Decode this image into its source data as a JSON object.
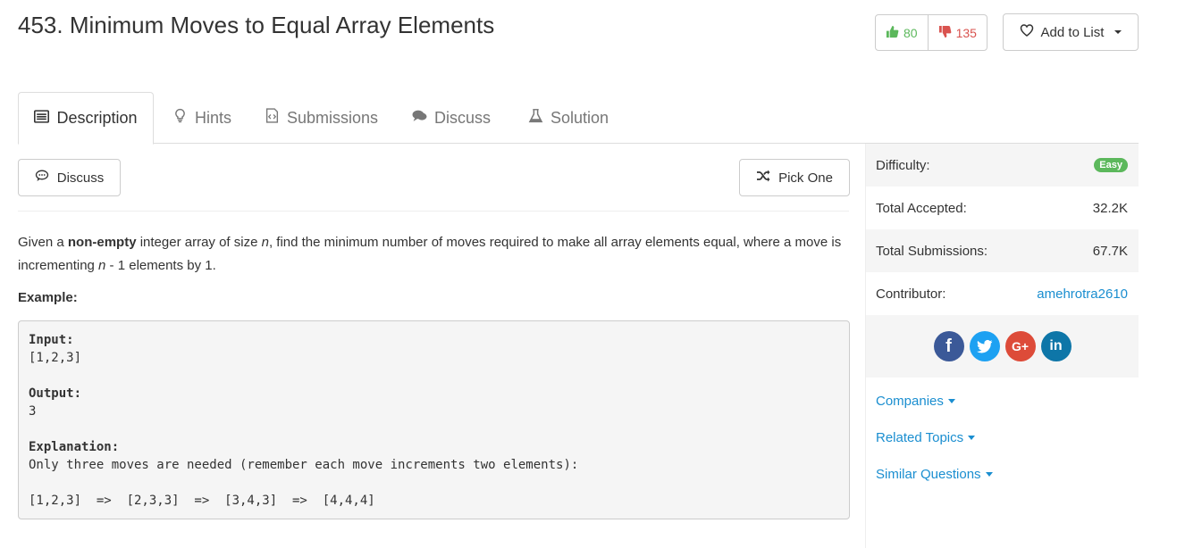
{
  "header": {
    "title": "453. Minimum Moves to Equal Array Elements",
    "upvotes": "80",
    "downvotes": "135",
    "add_to_list": "Add to List"
  },
  "tabs": [
    {
      "label": "Description",
      "icon": "list-icon"
    },
    {
      "label": "Hints",
      "icon": "lightbulb-icon"
    },
    {
      "label": "Submissions",
      "icon": "file-code-icon"
    },
    {
      "label": "Discuss",
      "icon": "comments-icon"
    },
    {
      "label": "Solution",
      "icon": "flask-icon"
    }
  ],
  "toolbar": {
    "discuss_label": "Discuss",
    "pick_one_label": "Pick One"
  },
  "problem": {
    "text_1": "Given a ",
    "bold_1": "non-empty",
    "text_2": " integer array of size ",
    "var_n": "n",
    "text_3": ", find the minimum number of moves required to make all array elements equal, where a move is incrementing ",
    "var_n2": "n",
    "text_4": " - 1 elements by 1.",
    "example_label": "Example:",
    "example": {
      "input_label": "Input:",
      "input_value": "[1,2,3]",
      "output_label": "Output:",
      "output_value": "3",
      "explanation_label": "Explanation:",
      "explanation_text": "Only three moves are needed (remember each move increments two elements):",
      "sequence": "[1,2,3]  =>  [2,3,3]  =>  [3,4,3]  =>  [4,4,4]"
    }
  },
  "sidebar": {
    "difficulty_label": "Difficulty:",
    "difficulty_value": "Easy",
    "accepted_label": "Total Accepted:",
    "accepted_value": "32.2K",
    "submissions_label": "Total Submissions:",
    "submissions_value": "67.7K",
    "contributor_label": "Contributor:",
    "contributor_value": "amehrotra2610",
    "social": [
      {
        "icon": "facebook-icon",
        "glyph": "f",
        "color": "#3b5998"
      },
      {
        "icon": "twitter-icon",
        "glyph": "t",
        "color": "#1da1f2"
      },
      {
        "icon": "google-plus-icon",
        "glyph": "G+",
        "color": "#dd4b39"
      },
      {
        "icon": "linkedin-icon",
        "glyph": "in",
        "color": "#0e76a8"
      }
    ],
    "links": [
      "Companies",
      "Related Topics",
      "Similar Questions"
    ]
  },
  "colors": {
    "link": "#1a8ed0",
    "easy": "#5cb85c",
    "upvote": "#5cb85c",
    "downvote": "#d9534f"
  }
}
